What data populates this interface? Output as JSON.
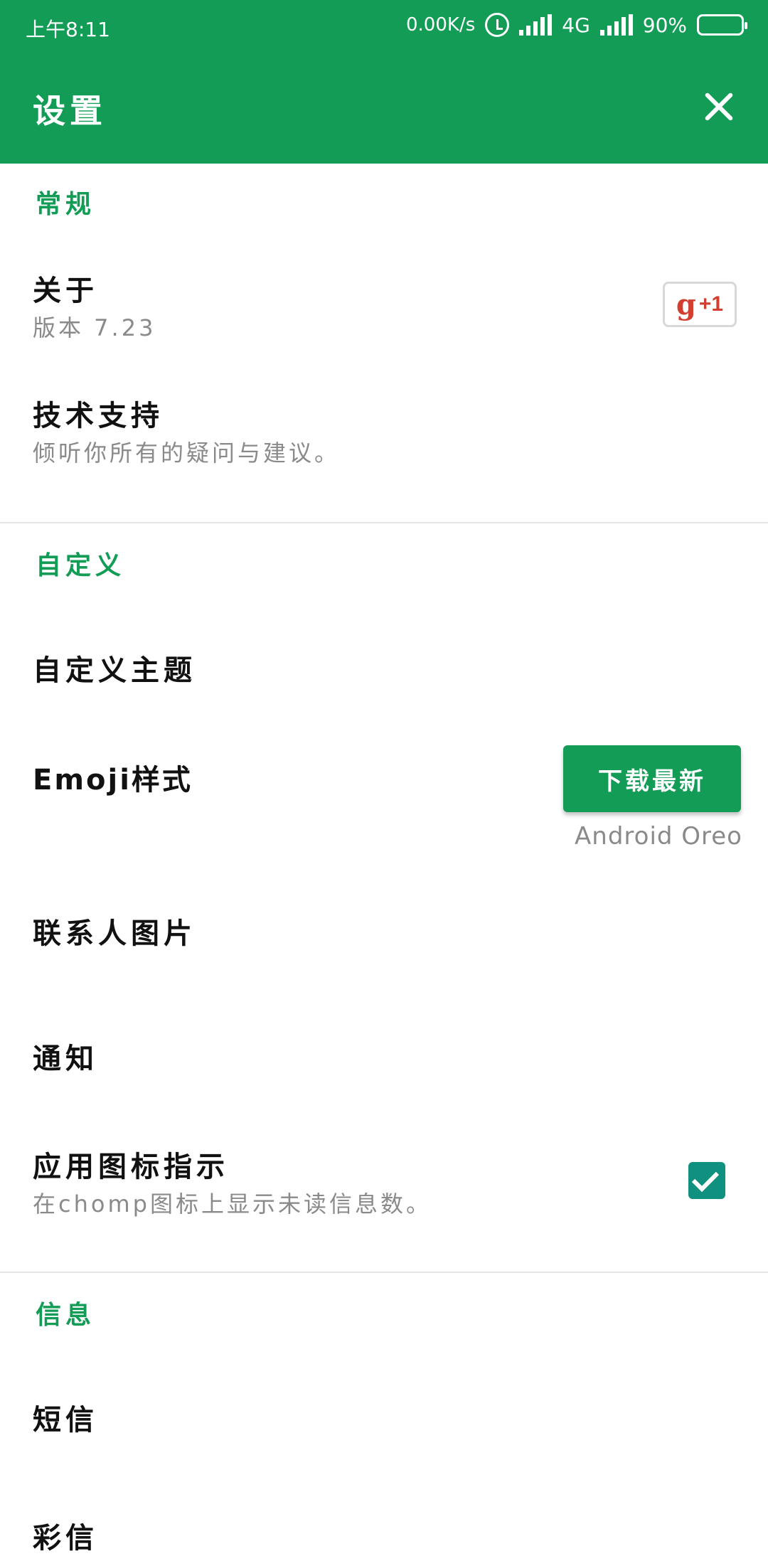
{
  "status_bar": {
    "time": "上午8:11",
    "net_speed": "0.00K/s",
    "network": "4G",
    "battery": "90%",
    "battery_color": "#f2a832"
  },
  "toolbar": {
    "title": "设置",
    "close_icon": "close-icon"
  },
  "colors": {
    "primary": "#139c56",
    "checkbox": "#10917f",
    "subtext": "#8a8a8a"
  },
  "sections": {
    "general": {
      "header": "常规",
      "about_title": "关于",
      "about_sub": "版本 7.23",
      "gplus_label": "g",
      "gplus_suffix": "+1",
      "support_title": "技术支持",
      "support_sub": "倾听你所有的疑问与建议。"
    },
    "custom": {
      "header": "自定义",
      "theme_title": "自定义主题",
      "emoji_title": "Emoji样式",
      "download_label": "下载最新",
      "emoji_value": "Android Oreo",
      "contact_title": "联系人图片",
      "notify_title": "通知",
      "badge_title": "应用图标指示",
      "badge_sub": "在chomp图标上显示未读信息数。",
      "badge_checked": true
    },
    "message": {
      "header": "信息",
      "sms_title": "短信",
      "mms_title": "彩信"
    }
  }
}
